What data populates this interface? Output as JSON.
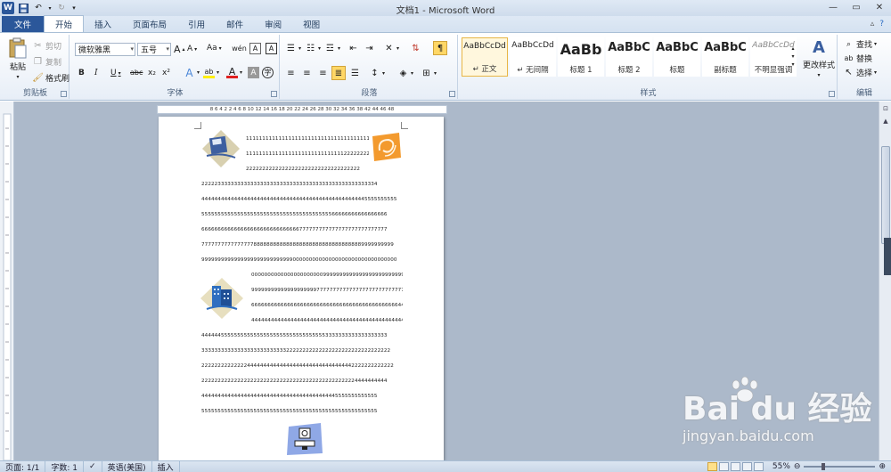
{
  "window": {
    "title": "文档1 - Microsoft Word"
  },
  "qat": {
    "word_logo": "W"
  },
  "tabs": [
    {
      "label": "文件"
    },
    {
      "label": "开始"
    },
    {
      "label": "插入"
    },
    {
      "label": "页面布局"
    },
    {
      "label": "引用"
    },
    {
      "label": "邮件"
    },
    {
      "label": "审阅"
    },
    {
      "label": "视图"
    }
  ],
  "clipboard": {
    "paste": "粘贴",
    "cut": "剪切",
    "copy": "复制",
    "format_painter": "格式刷",
    "label": "剪贴板"
  },
  "font": {
    "name": "微软雅黑",
    "size": "五号",
    "label": "字体",
    "grow": "A",
    "shrink": "A",
    "case": "Aa",
    "bold": "B",
    "italic": "I",
    "underline": "U",
    "strike": "abc",
    "sub": "x₂",
    "sup": "x²",
    "font_color": "A"
  },
  "paragraph": {
    "label": "段落"
  },
  "styles": {
    "label": "样式",
    "items": [
      {
        "preview": "AaBbCcDd",
        "name": "↵ 正文"
      },
      {
        "preview": "AaBbCcDd",
        "name": "↵ 无间隔"
      },
      {
        "preview": "AaBb",
        "name": "标题 1"
      },
      {
        "preview": "AaBbC",
        "name": "标题 2"
      },
      {
        "preview": "AaBbC",
        "name": "标题"
      },
      {
        "preview": "AaBbC",
        "name": "副标题"
      },
      {
        "preview": "AaBbCcDd",
        "name": "不明显强调"
      }
    ],
    "change_styles": "更改样式"
  },
  "editing": {
    "find": "查找",
    "replace": "替换",
    "select": "选择",
    "label": "编辑"
  },
  "ruler": {
    "ticks": "8 6 4 2 2 4 6 8 10 12 14 16 18 20 22 24 26 28 30 32 34 36 38 42 44 46 48"
  },
  "document": {
    "lines": [
      "111111111111111111111111111111111111111",
      "11111111111111111111111111111122222222",
      "22222222222222222222222222222222222",
      "222223333333333333333333333333333333333333333333333334",
      "444444444444444444444444444444444444444444444444445555555555",
      "555555555555555555555555555555555555555566666666666666666",
      "666666666666666666666666666666777777777777777777777777777",
      "77777777777777778888888888888888888888888888888889999999999",
      "999999999999999999999999999900000000000000000000000000000000",
      "000000000000000000000099999999999999999999999999999999",
      "999999999999999999997777777777777777777777777777667666",
      "66666666666666666666666666666666666666666666644444444",
      "44444444444444444444444444444444444444444444444444444",
      "444444555555555555555555555555555555553333333333333333333",
      "3333333333333333333333333322222222222222222222222222222222",
      "22222222222222444444444444444444444444444444442222222222222",
      "222222222222222222222222222222222222222222222224444444444",
      "444444444444444444444444444444444444444445555555555555",
      "555555555555555555555555555555555555555555555555555555"
    ]
  },
  "status": {
    "page": "页面: 1/1",
    "words": "字数: 1",
    "lang": "英语(美国)",
    "mode": "插入",
    "zoom": "55%"
  },
  "watermark": {
    "logo": "Bai du 经验",
    "url": "jingyan.baidu.com"
  }
}
